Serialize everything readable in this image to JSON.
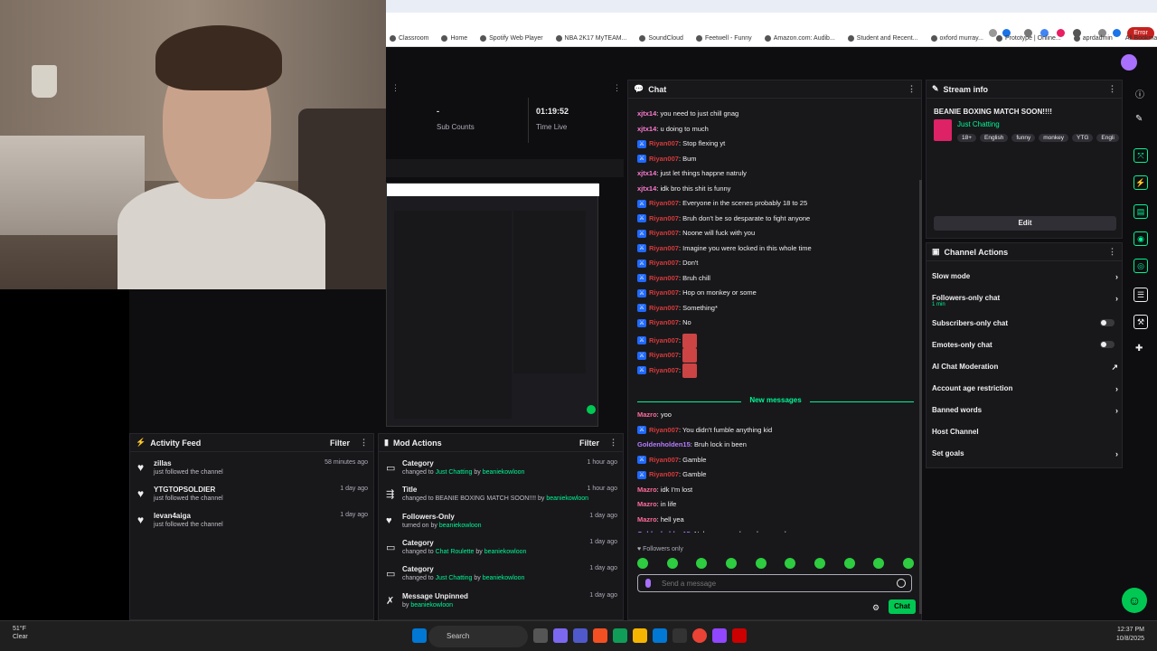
{
  "browser": {
    "bookmarks": [
      "Classroom",
      "Home",
      "Spotify Web Player",
      "NBA 2K17 MyTEAM...",
      "SoundCloud",
      "Feetwell - Funny",
      "Amazon.com: Audib...",
      "Student and Recent...",
      "oxford murray...",
      "Prototype | Online...",
      "aprdadmin"
    ],
    "all_bookmarks": "All Bookmarks",
    "error_label": "Error"
  },
  "stats": {
    "sub_counts_value": "-",
    "sub_counts_label": "Sub Counts",
    "time_live_value": "01:19:52",
    "time_live_label": "Time Live"
  },
  "activity_feed": {
    "title": "Activity Feed",
    "filter": "Filter",
    "items": [
      {
        "name": "zillas",
        "sub": "just followed the channel",
        "time": "58 minutes ago"
      },
      {
        "name": "YTGTOPSOLDIER",
        "sub": "just followed the channel",
        "time": "1 day ago"
      },
      {
        "name": "levan4aiga",
        "sub": "just followed the channel",
        "time": "1 day ago"
      }
    ]
  },
  "mod_actions": {
    "title": "Mod Actions",
    "filter": "Filter",
    "items": [
      {
        "title": "Category",
        "pre": "changed to ",
        "hl": "Just Chatting",
        "mid": " by ",
        "by": "beaniekowloon",
        "time": "1 hour ago"
      },
      {
        "title": "Title",
        "pre": "changed to BEANIE BOXING MATCH SOON!!!! by ",
        "hl": "",
        "mid": "",
        "by": "beaniekowloon",
        "time": "1 hour ago"
      },
      {
        "title": "Followers-Only",
        "pre": "turned on by ",
        "hl": "",
        "mid": "",
        "by": "beaniekowloon",
        "time": "1 day ago"
      },
      {
        "title": "Category",
        "pre": "changed to ",
        "hl": "Chat Roulette",
        "mid": " by ",
        "by": "beaniekowloon",
        "time": "1 day ago"
      },
      {
        "title": "Category",
        "pre": "changed to ",
        "hl": "Just Chatting",
        "mid": " by ",
        "by": "beaniekowloon",
        "time": "1 day ago"
      },
      {
        "title": "Message Unpinned",
        "pre": "by ",
        "hl": "",
        "mid": "",
        "by": "beaniekowloon",
        "time": "1 day ago"
      }
    ]
  },
  "chat": {
    "title": "Chat",
    "new_messages": "New messages",
    "followers_only": "Followers only",
    "input_placeholder": "Send a message",
    "send_label": "Chat",
    "colors": {
      "xjtx14": "#ff7ad0",
      "Riyan007": "#d63a3a",
      "Mazro": "#ff6b9a",
      "Goldenholden15": "#b57cff"
    },
    "messages": [
      {
        "user": "xjtx14",
        "text": "you need to just chill gnag",
        "badge": false
      },
      {
        "user": "xjtx14",
        "text": "u doing to much",
        "badge": false
      },
      {
        "user": "Riyan007",
        "text": "Stop flexing yt",
        "badge": true
      },
      {
        "user": "Riyan007",
        "text": "Bum",
        "badge": true
      },
      {
        "user": "xjtx14",
        "text": "just let things happne natruly",
        "badge": false
      },
      {
        "user": "xjtx14",
        "text": "idk bro this shit is funny",
        "badge": false
      },
      {
        "user": "Riyan007",
        "text": "Everyone in the scenes probably 18 to 25",
        "badge": true
      },
      {
        "user": "Riyan007",
        "text": "Bruh don't be so desparate to fight anyone",
        "badge": true
      },
      {
        "user": "Riyan007",
        "text": "Noone will fuck with you",
        "badge": true
      },
      {
        "user": "Riyan007",
        "text": "Imagine you were locked in this whole time",
        "badge": true
      },
      {
        "user": "Riyan007",
        "text": "Don't",
        "badge": true
      },
      {
        "user": "Riyan007",
        "text": "Bruh chill",
        "badge": true
      },
      {
        "user": "Riyan007",
        "text": "Hop on monkey or some",
        "badge": true
      },
      {
        "user": "Riyan007",
        "text": "Something*",
        "badge": true
      },
      {
        "user": "Riyan007",
        "text": "No",
        "badge": true
      },
      {
        "user": "Riyan007",
        "text": "",
        "badge": true,
        "emote": true
      },
      {
        "user": "Riyan007",
        "text": "",
        "badge": true,
        "emote": true
      },
      {
        "user": "Riyan007",
        "text": "",
        "badge": true,
        "emote": true
      }
    ],
    "new": [
      {
        "user": "Mazro",
        "text": "yoo",
        "badge": false
      },
      {
        "user": "Riyan007",
        "text": "You didn't fumble anything kid",
        "badge": true
      },
      {
        "user": "Goldenholden15",
        "text": "Bruh lock in been",
        "badge": false
      },
      {
        "user": "Riyan007",
        "text": "Gamble",
        "badge": true
      },
      {
        "user": "Riyan007",
        "text": "Gamble",
        "badge": true
      },
      {
        "user": "Mazro",
        "text": "idk I'm lost",
        "badge": false
      },
      {
        "user": "Mazro",
        "text": "in life",
        "badge": false
      },
      {
        "user": "Mazro",
        "text": "hell yea",
        "badge": false
      },
      {
        "user": "Goldenholden15",
        "text": "Nah we passed our depressed arc",
        "badge": false
      },
      {
        "user": "Mazro",
        "text": "my ex bro how do u get over them",
        "badge": false
      }
    ]
  },
  "stream_info": {
    "title": "Stream info",
    "stream_title": "BEANIE BOXING MATCH SOON!!!!",
    "category": "Just Chatting",
    "tags": [
      "18+",
      "English",
      "funny",
      "monkey",
      "YTG",
      "Engli"
    ],
    "edit_label": "Edit"
  },
  "channel_actions": {
    "title": "Channel Actions",
    "items": [
      {
        "label": "Slow mode",
        "control": "chevron"
      },
      {
        "label": "Followers-only chat",
        "sub": "1 min",
        "control": "chevron"
      },
      {
        "label": "Subscribers-only chat",
        "control": "toggle"
      },
      {
        "label": "Emotes-only chat",
        "control": "toggle"
      },
      {
        "label": "AI Chat Moderation",
        "control": "external"
      },
      {
        "label": "Account age restriction",
        "control": "chevron"
      },
      {
        "label": "Banned words",
        "control": "chevron"
      },
      {
        "label": "Host Channel",
        "control": "none"
      },
      {
        "label": "Set goals",
        "control": "chevron"
      }
    ]
  },
  "taskbar": {
    "weather_temp": "51°F",
    "weather_desc": "Clear",
    "search": "Search",
    "time": "12:37 PM",
    "date": "10/8/2025"
  }
}
